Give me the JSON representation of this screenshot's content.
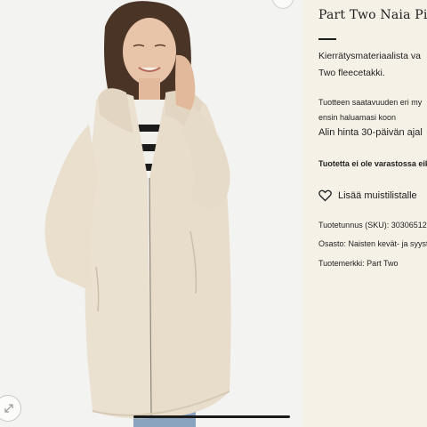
{
  "product": {
    "breadcrumb": "...",
    "title": "Part Two Naia Pi",
    "description_line1": "Kierrätysmateriaalista va",
    "description_line2": "Two fleecetakki.",
    "availability_line1": "Tuotteen saatavuuden eri my",
    "availability_line2": "ensin haluamasi koon",
    "lowest_price": "Alin hinta 30-päivän ajal",
    "stock_status": "Tuotetta ei ole varastossa eik",
    "wishlist_label": "Lisää muistilistalle",
    "sku": "Tuotetunnus (SKU): 30306512",
    "department": "Osasto: Naisten kevät- ja syyst",
    "brand": "Tuotemerkki: Part Two"
  },
  "colors": {
    "panel_bg": "#f6f1e7",
    "image_bg": "#f4f4f2",
    "coat": "#e9dfcd",
    "text": "#1f1f1f"
  },
  "icons": {
    "wishlist": "heart-icon",
    "zoom": "zoom-icon"
  }
}
